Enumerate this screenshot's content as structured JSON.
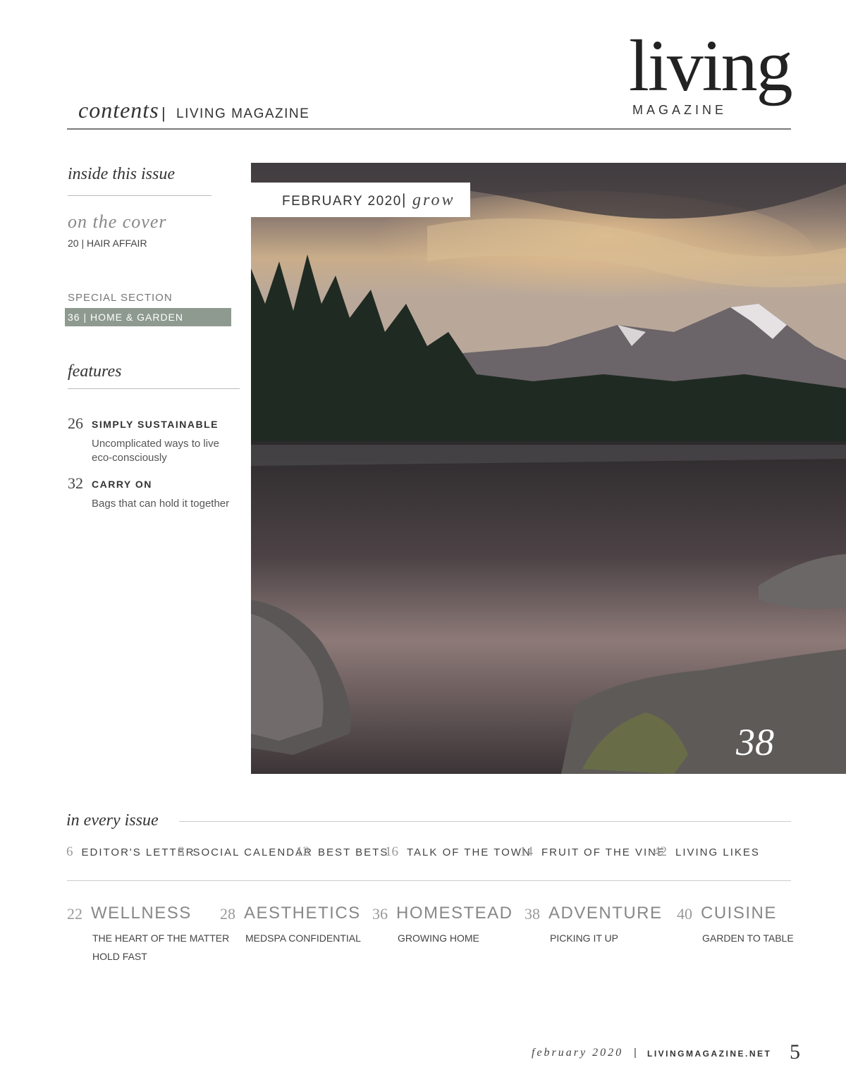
{
  "header": {
    "section_title": "contents",
    "separator": "|",
    "magazine_name": "LIVING MAGAZINE",
    "logo_word": "living",
    "logo_sub": "MAGAZINE"
  },
  "sidebar": {
    "title": "inside this issue",
    "cover_heading": "on the cover",
    "cover_item": "20 | HAIR AFFAIR",
    "special_heading": "SPECIAL SECTION",
    "special_item": "36 | HOME & GARDEN",
    "features_heading": "features",
    "features": [
      {
        "page": "26",
        "title": "SIMPLY SUSTAINABLE",
        "desc": "Uncomplicated ways to live eco-consciously"
      },
      {
        "page": "32",
        "title": "CARRY ON",
        "desc": "Bags that can hold it together"
      }
    ]
  },
  "photo": {
    "label_date": "FEBRUARY 2020",
    "label_sep": "|",
    "label_theme": "grow",
    "page_number": "38"
  },
  "every_issue": {
    "title": "in every issue",
    "items": [
      {
        "page": "6",
        "label": "EDITOR'S LETTER"
      },
      {
        "page": "8",
        "label": "SOCIAL CALENDAR"
      },
      {
        "page": "12",
        "label": "BEST BETS"
      },
      {
        "page": "16",
        "label": "TALK OF THE TOWN"
      },
      {
        "page": "14",
        "label": "FRUIT OF THE VINE"
      },
      {
        "page": "42",
        "label": "LIVING LIKES"
      }
    ]
  },
  "departments": [
    {
      "page": "22",
      "name": "WELLNESS",
      "items": [
        "THE HEART OF THE MATTER",
        "HOLD FAST"
      ]
    },
    {
      "page": "28",
      "name": "AESTHETICS",
      "items": [
        "MEDSPA CONFIDENTIAL"
      ]
    },
    {
      "page": "36",
      "name": "HOMESTEAD",
      "items": [
        "GROWING HOME"
      ]
    },
    {
      "page": "38",
      "name": "ADVENTURE",
      "items": [
        "PICKING IT UP"
      ]
    },
    {
      "page": "40",
      "name": "CUISINE",
      "items": [
        "GARDEN TO TABLE"
      ]
    }
  ],
  "footer": {
    "issue_date": "february 2020",
    "separator": "|",
    "website": "LIVINGMAGAZINE.NET",
    "page_number": "5"
  },
  "colors": {
    "highlight": "#8e9a8f",
    "rule": "#7a7a7a"
  }
}
